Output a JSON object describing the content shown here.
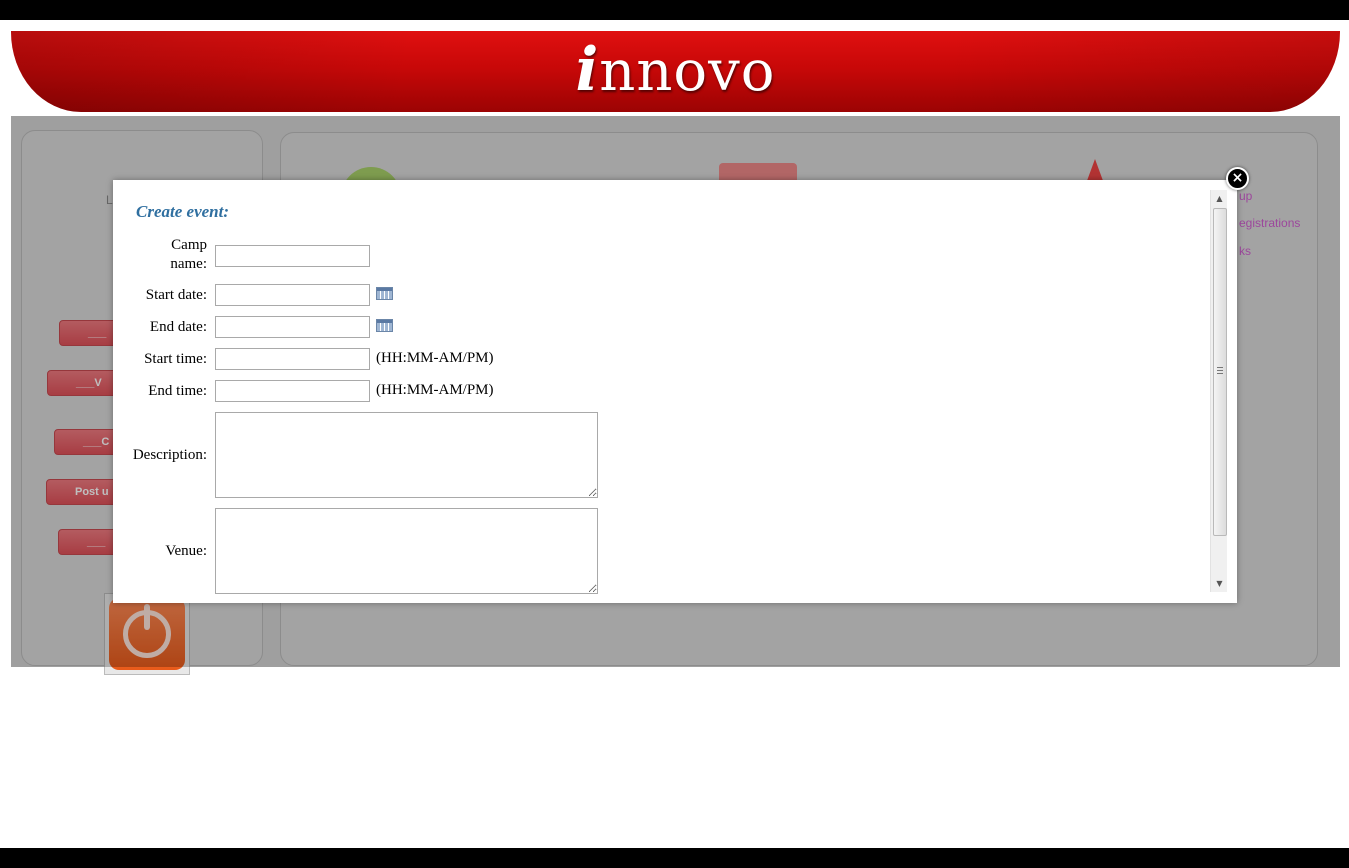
{
  "header": {
    "logo_mark": "i",
    "logo_text": "nnovo"
  },
  "background": {
    "login_text": "Log",
    "login_sub": "N",
    "nav_buttons": [
      "___",
      "___V",
      "___C",
      "Post u",
      "___"
    ],
    "side_links": [
      "up",
      "egistrations",
      "ks"
    ]
  },
  "modal": {
    "close_label": "×",
    "title": "Create event:",
    "fields": {
      "camp_name_label_1": "Camp",
      "camp_name_label_2": "name:",
      "camp_name_value": "",
      "start_date_label": "Start date:",
      "start_date_value": "",
      "end_date_label": "End date:",
      "end_date_value": "",
      "start_time_label": "Start time:",
      "start_time_value": "",
      "start_time_hint": "(HH:MM-AM/PM)",
      "end_time_label": "End time:",
      "end_time_value": "",
      "end_time_hint": "(HH:MM-AM/PM)",
      "description_label": "Description:",
      "description_value": "",
      "venue_label": "Venue:",
      "venue_value": ""
    },
    "icons": {
      "calendar": "calendar-icon",
      "close": "close-icon"
    }
  }
}
